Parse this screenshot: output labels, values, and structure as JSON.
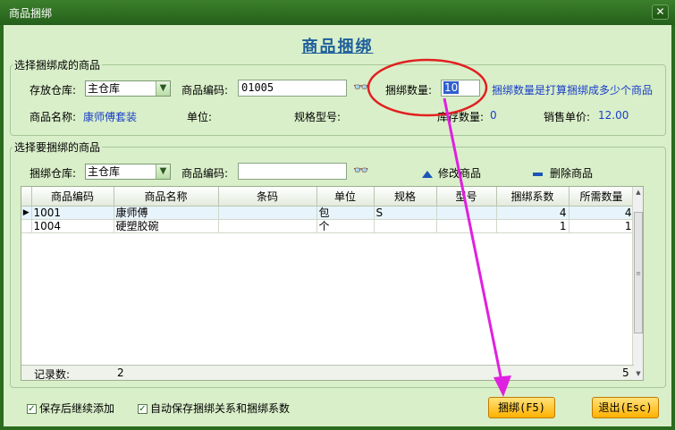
{
  "window": {
    "title": "商品捆绑",
    "close_glyph": "✕"
  },
  "heading": "商品捆绑",
  "bundle_section": {
    "legend": "选择捆绑成的商品",
    "warehouse_label": "存放仓库:",
    "warehouse_value": "主仓库",
    "code_label": "商品编码:",
    "code_value": "01005",
    "qty_label": "捆绑数量:",
    "qty_value": "10",
    "qty_hint": "捆绑数量是打算捆绑成多少个商品",
    "name_label": "商品名称:",
    "name_value": "康师傅套装",
    "unit_label": "单位:",
    "spec_label": "规格型号:",
    "stock_label": "库存数量:",
    "stock_value": "0",
    "price_label": "销售单价:",
    "price_value": "12.00"
  },
  "component_section": {
    "legend": "选择要捆绑的商品",
    "warehouse_label": "捆绑仓库:",
    "warehouse_value": "主仓库",
    "code_label": "商品编码:",
    "code_value": "",
    "modify_label": "修改商品",
    "delete_label": "删除商品"
  },
  "grid": {
    "columns": [
      "商品编码",
      "商品名称",
      "条码",
      "单位",
      "规格",
      "型号",
      "捆绑系数",
      "所需数量"
    ],
    "rows": [
      {
        "code": "1001",
        "name": "康师傅",
        "barcode": "",
        "unit": "包",
        "spec": "S",
        "model": "",
        "factor": "4",
        "required": "4"
      },
      {
        "code": "1004",
        "name": "硬塑胶碗",
        "barcode": "",
        "unit": "个",
        "spec": "",
        "model": "",
        "factor": "1",
        "required": "1"
      }
    ],
    "footer_label": "记录数:",
    "footer_count": "2",
    "footer_total": "5"
  },
  "options": {
    "keep_adding": "保存后继续添加",
    "auto_save": "自动保存捆绑关系和捆绑系数"
  },
  "buttons": {
    "bundle": "捆绑(F5)",
    "exit": "退出(Esc)"
  },
  "icons": {
    "binoculars": "binoculars-icon",
    "dropdown": "chevron-down-icon",
    "modify": "triangle-up-icon",
    "delete": "minus-icon"
  },
  "colors": {
    "titlebar": "#2a6b1e",
    "panel": "#d9efc9",
    "heading": "#1d5f9a",
    "link_blue": "#1a3fc9",
    "button": "#ffb100",
    "annotation_red": "#e02020",
    "annotation_arrow": "#e020e0"
  }
}
